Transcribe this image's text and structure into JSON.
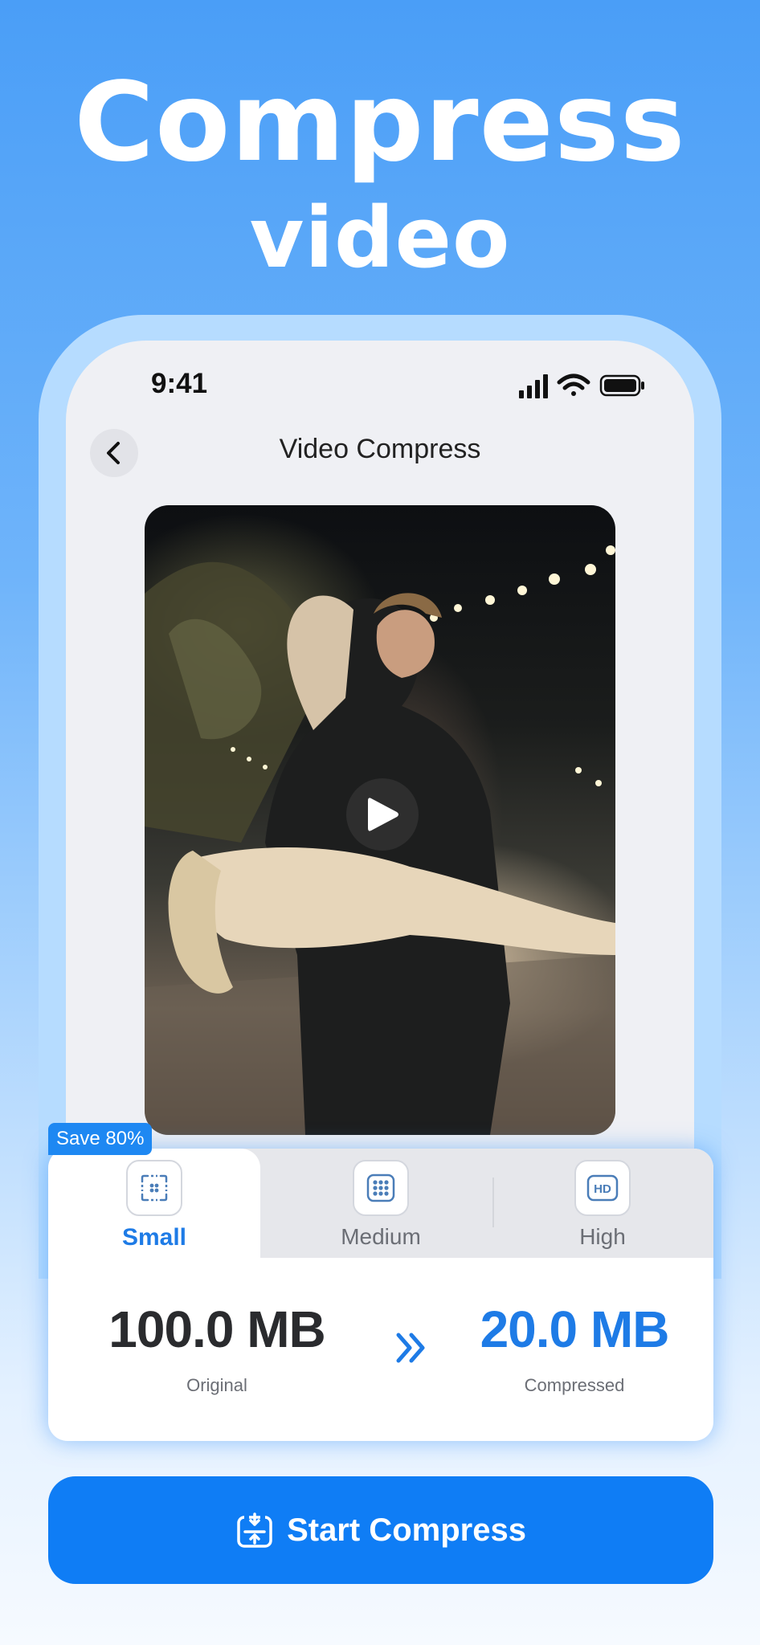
{
  "hero": {
    "line1": "Compress",
    "line2": "video"
  },
  "status_bar": {
    "time": "9:41"
  },
  "nav": {
    "title": "Video Compress"
  },
  "badge": {
    "save": "Save 80%"
  },
  "quality_tabs": [
    {
      "label": "Small",
      "icon": "small-grid-icon",
      "selected": true
    },
    {
      "label": "Medium",
      "icon": "medium-grid-icon",
      "selected": false
    },
    {
      "label": "High",
      "icon": "hd-icon",
      "selected": false
    }
  ],
  "sizes": {
    "original_value": "100.0 MB",
    "original_label": "Original",
    "compressed_value": "20.0 MB",
    "compressed_label": "Compressed"
  },
  "cta": {
    "label": "Start Compress",
    "icon": "compress-icon"
  },
  "colors": {
    "accent": "#1E7BE6",
    "button": "#0F7DF5",
    "badge": "#1E88F2"
  }
}
